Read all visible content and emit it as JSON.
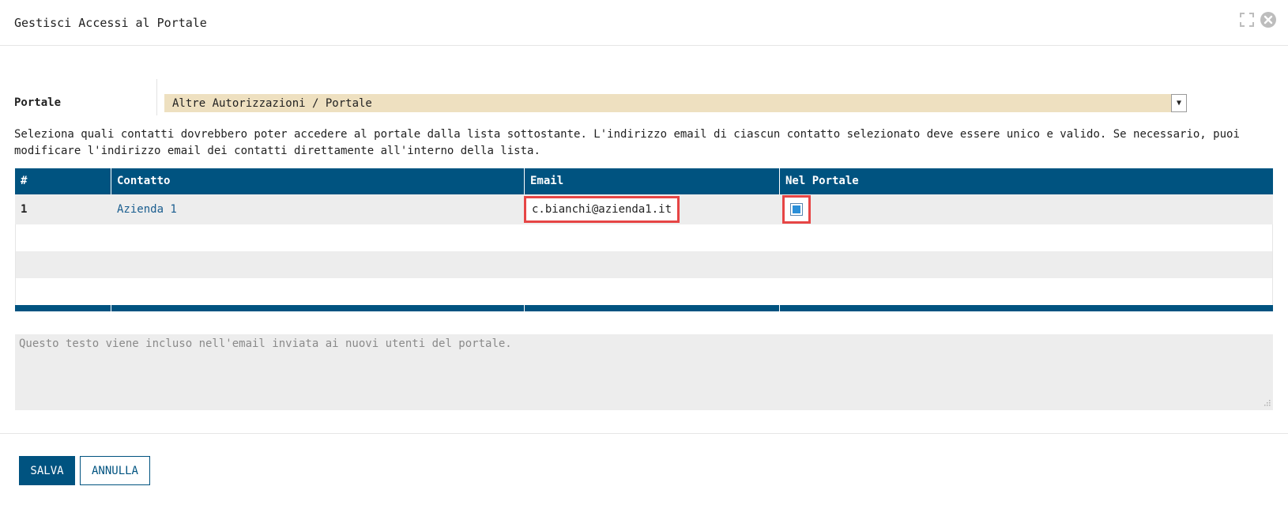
{
  "dialog": {
    "title": "Gestisci Accessi al Portale",
    "icons": [
      "expand-icon",
      "close-icon"
    ]
  },
  "portal": {
    "label": "Portale",
    "selected": "Altre Autorizzazioni / Portale"
  },
  "help_text": "Seleziona quali contatti dovrebbero poter accedere al portale dalla lista sottostante. L'indirizzo email di ciascun contatto selezionato deve essere unico e valido. Se necessario, puoi modificare l'indirizzo email dei contatti direttamente all'interno della lista.",
  "table": {
    "columns": [
      "#",
      "Contatto",
      "Email",
      "Nel Portale"
    ],
    "rows": [
      {
        "num": "1",
        "contact": "Azienda 1",
        "email": "c.bianchi@azienda1.it",
        "in_portal": true
      }
    ]
  },
  "note": {
    "placeholder": "Questo testo viene incluso nell'email inviata ai nuovi utenti del portale."
  },
  "buttons": {
    "save": "SALVA",
    "cancel": "ANNULLA"
  },
  "colors": {
    "header_blue": "#005380",
    "select_bg": "#eee0c0",
    "highlight_red": "#e64545",
    "link": "#1a5d8f"
  }
}
